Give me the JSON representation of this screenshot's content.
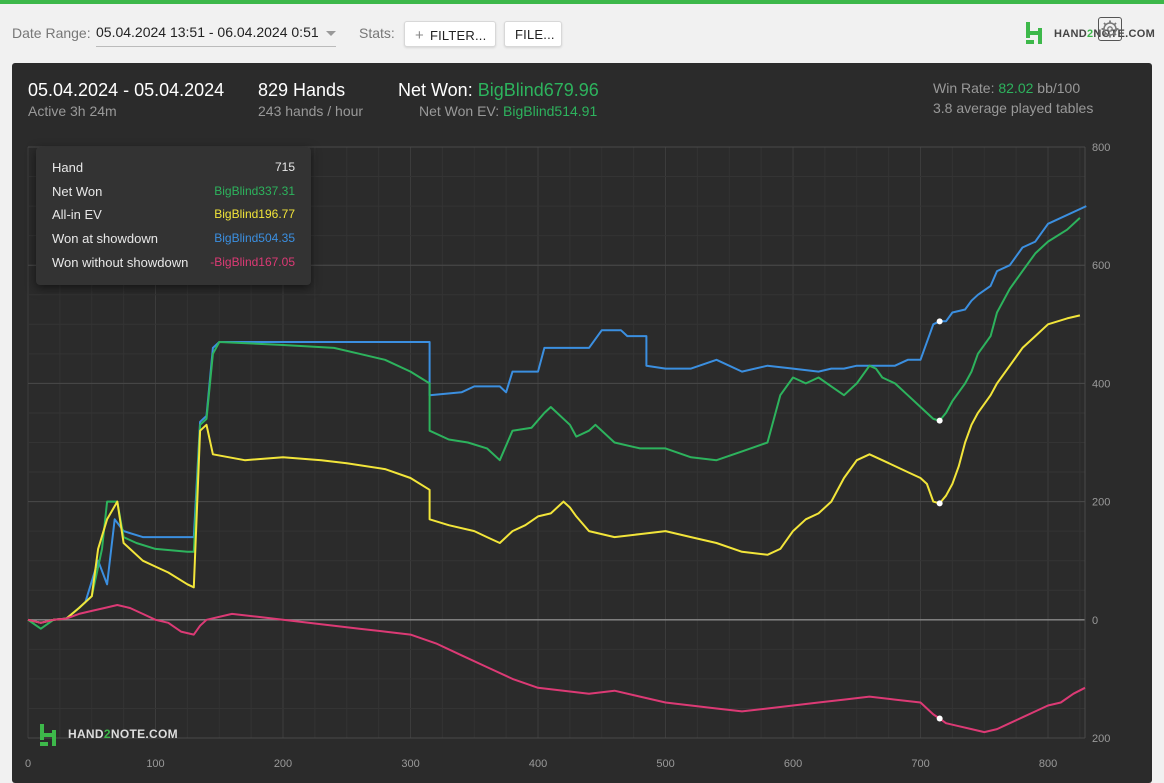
{
  "toolbar": {
    "date_range_label": "Date Range:",
    "date_range_value": "05.04.2024 13:51 - 06.04.2024 0:51",
    "stats_label": "Stats:",
    "filter_button": "FILTER...",
    "file_button": "FILE...",
    "logo_text_pre": "HAND",
    "logo_text_two": "2",
    "logo_text_post": "NOTE.COM"
  },
  "summary": {
    "dates": "05.04.2024 - 05.04.2024",
    "active": "Active 3h 24m",
    "hands": "829 Hands",
    "hands_per_hour": "243 hands / hour",
    "net_won_label": "Net Won:",
    "net_won_value": "BigBlind679.96",
    "net_won_ev_label": "Net Won  EV:",
    "net_won_ev_value": "BigBlind514.91",
    "win_rate_label": "Win Rate:",
    "win_rate_value": "82.02",
    "win_rate_unit": "bb/100",
    "avg_tables": "3.8 average played tables"
  },
  "tooltip": {
    "rows": [
      {
        "label": "Hand",
        "value": "715",
        "color": "#e8e8e8"
      },
      {
        "label": "Net Won",
        "value": "BigBlind337.31",
        "color": "#2db35d"
      },
      {
        "label": "All-in EV",
        "value": "BigBlind196.77",
        "color": "#f2e53a"
      },
      {
        "label": "Won at showdown",
        "value": "BigBlind504.35",
        "color": "#3b8fe0"
      },
      {
        "label": "Won without showdown",
        "value": "-BigBlind167.05",
        "color": "#dc3a75"
      }
    ]
  },
  "watermark": {
    "pre": "HAND",
    "two": "2",
    "post": "NOTE.COM"
  },
  "icons": {
    "gear": "gear-icon",
    "logo": "hand2note-logo-icon",
    "plus": "plus-icon",
    "caret": "chevron-down-icon"
  },
  "chart_data": {
    "type": "line",
    "xlim": [
      0,
      829
    ],
    "ylim": [
      -200,
      800
    ],
    "x_ticks": [
      0,
      100,
      200,
      300,
      400,
      500,
      600,
      700,
      800
    ],
    "y_ticks": [
      800,
      600,
      400,
      200,
      0,
      200
    ],
    "y_tick_values": [
      800,
      600,
      400,
      200,
      0,
      -200
    ],
    "grid": true,
    "highlight_x": 715,
    "series": [
      {
        "name": "Won at showdown",
        "color": "#3b8fe0",
        "points": [
          [
            0,
            0
          ],
          [
            10,
            -5
          ],
          [
            20,
            0
          ],
          [
            30,
            2
          ],
          [
            40,
            20
          ],
          [
            45,
            30
          ],
          [
            55,
            100
          ],
          [
            62,
            60
          ],
          [
            68,
            170
          ],
          [
            75,
            150
          ],
          [
            90,
            140
          ],
          [
            130,
            140
          ],
          [
            135,
            335
          ],
          [
            140,
            345
          ],
          [
            145,
            460
          ],
          [
            150,
            470
          ],
          [
            200,
            470
          ],
          [
            250,
            470
          ],
          [
            300,
            470
          ],
          [
            315,
            470
          ],
          [
            315,
            380
          ],
          [
            340,
            385
          ],
          [
            350,
            395
          ],
          [
            370,
            395
          ],
          [
            375,
            385
          ],
          [
            380,
            420
          ],
          [
            400,
            420
          ],
          [
            405,
            460
          ],
          [
            430,
            460
          ],
          [
            440,
            460
          ],
          [
            450,
            490
          ],
          [
            460,
            490
          ],
          [
            465,
            490
          ],
          [
            470,
            480
          ],
          [
            480,
            480
          ],
          [
            485,
            480
          ],
          [
            485,
            430
          ],
          [
            500,
            425
          ],
          [
            520,
            425
          ],
          [
            540,
            440
          ],
          [
            560,
            420
          ],
          [
            580,
            430
          ],
          [
            600,
            425
          ],
          [
            620,
            420
          ],
          [
            630,
            425
          ],
          [
            640,
            425
          ],
          [
            650,
            430
          ],
          [
            665,
            430
          ],
          [
            680,
            430
          ],
          [
            690,
            440
          ],
          [
            700,
            440
          ],
          [
            710,
            500
          ],
          [
            715,
            505
          ],
          [
            720,
            505
          ],
          [
            725,
            520
          ],
          [
            735,
            525
          ],
          [
            740,
            540
          ],
          [
            745,
            550
          ],
          [
            755,
            565
          ],
          [
            760,
            590
          ],
          [
            770,
            600
          ],
          [
            780,
            630
          ],
          [
            790,
            640
          ],
          [
            800,
            670
          ],
          [
            830,
            700
          ]
        ]
      },
      {
        "name": "Net Won",
        "color": "#2db35d",
        "points": [
          [
            0,
            0
          ],
          [
            10,
            -15
          ],
          [
            20,
            0
          ],
          [
            30,
            2
          ],
          [
            40,
            20
          ],
          [
            50,
            40
          ],
          [
            58,
            120
          ],
          [
            62,
            200
          ],
          [
            70,
            200
          ],
          [
            75,
            140
          ],
          [
            85,
            130
          ],
          [
            100,
            120
          ],
          [
            125,
            115
          ],
          [
            130,
            115
          ],
          [
            135,
            330
          ],
          [
            140,
            340
          ],
          [
            145,
            450
          ],
          [
            150,
            470
          ],
          [
            200,
            465
          ],
          [
            240,
            460
          ],
          [
            260,
            450
          ],
          [
            280,
            440
          ],
          [
            300,
            420
          ],
          [
            315,
            400
          ],
          [
            315,
            320
          ],
          [
            330,
            305
          ],
          [
            345,
            300
          ],
          [
            360,
            290
          ],
          [
            370,
            270
          ],
          [
            380,
            320
          ],
          [
            395,
            325
          ],
          [
            405,
            350
          ],
          [
            410,
            360
          ],
          [
            425,
            330
          ],
          [
            430,
            310
          ],
          [
            440,
            320
          ],
          [
            445,
            330
          ],
          [
            460,
            300
          ],
          [
            480,
            290
          ],
          [
            500,
            290
          ],
          [
            520,
            275
          ],
          [
            540,
            270
          ],
          [
            560,
            285
          ],
          [
            580,
            300
          ],
          [
            590,
            380
          ],
          [
            600,
            410
          ],
          [
            605,
            405
          ],
          [
            610,
            400
          ],
          [
            620,
            410
          ],
          [
            630,
            395
          ],
          [
            640,
            380
          ],
          [
            650,
            400
          ],
          [
            660,
            430
          ],
          [
            665,
            425
          ],
          [
            670,
            410
          ],
          [
            680,
            400
          ],
          [
            690,
            380
          ],
          [
            700,
            360
          ],
          [
            710,
            340
          ],
          [
            715,
            337
          ],
          [
            720,
            350
          ],
          [
            725,
            370
          ],
          [
            735,
            400
          ],
          [
            740,
            420
          ],
          [
            745,
            450
          ],
          [
            755,
            480
          ],
          [
            760,
            520
          ],
          [
            770,
            560
          ],
          [
            780,
            590
          ],
          [
            790,
            620
          ],
          [
            800,
            640
          ],
          [
            815,
            660
          ],
          [
            825,
            680
          ]
        ]
      },
      {
        "name": "All-in EV",
        "color": "#f2e53a",
        "points": [
          [
            0,
            0
          ],
          [
            10,
            -5
          ],
          [
            20,
            0
          ],
          [
            30,
            2
          ],
          [
            40,
            20
          ],
          [
            50,
            40
          ],
          [
            55,
            120
          ],
          [
            62,
            170
          ],
          [
            70,
            200
          ],
          [
            75,
            130
          ],
          [
            90,
            100
          ],
          [
            100,
            90
          ],
          [
            110,
            80
          ],
          [
            125,
            60
          ],
          [
            130,
            55
          ],
          [
            135,
            320
          ],
          [
            140,
            330
          ],
          [
            145,
            280
          ],
          [
            170,
            270
          ],
          [
            200,
            275
          ],
          [
            230,
            270
          ],
          [
            250,
            265
          ],
          [
            280,
            255
          ],
          [
            300,
            240
          ],
          [
            315,
            220
          ],
          [
            315,
            170
          ],
          [
            330,
            160
          ],
          [
            350,
            150
          ],
          [
            360,
            140
          ],
          [
            370,
            130
          ],
          [
            380,
            150
          ],
          [
            390,
            160
          ],
          [
            400,
            175
          ],
          [
            410,
            180
          ],
          [
            420,
            200
          ],
          [
            425,
            190
          ],
          [
            430,
            175
          ],
          [
            440,
            150
          ],
          [
            460,
            140
          ],
          [
            480,
            145
          ],
          [
            500,
            150
          ],
          [
            520,
            140
          ],
          [
            540,
            130
          ],
          [
            560,
            115
          ],
          [
            580,
            110
          ],
          [
            590,
            120
          ],
          [
            600,
            150
          ],
          [
            610,
            170
          ],
          [
            620,
            180
          ],
          [
            630,
            200
          ],
          [
            640,
            240
          ],
          [
            650,
            270
          ],
          [
            660,
            280
          ],
          [
            670,
            270
          ],
          [
            680,
            260
          ],
          [
            690,
            250
          ],
          [
            700,
            240
          ],
          [
            705,
            230
          ],
          [
            710,
            200
          ],
          [
            715,
            197
          ],
          [
            720,
            210
          ],
          [
            725,
            230
          ],
          [
            730,
            260
          ],
          [
            735,
            300
          ],
          [
            740,
            330
          ],
          [
            745,
            350
          ],
          [
            755,
            380
          ],
          [
            760,
            400
          ],
          [
            770,
            430
          ],
          [
            780,
            460
          ],
          [
            790,
            480
          ],
          [
            800,
            500
          ],
          [
            815,
            510
          ],
          [
            825,
            515
          ]
        ]
      },
      {
        "name": "Won without showdown",
        "color": "#dc3a75",
        "points": [
          [
            0,
            0
          ],
          [
            10,
            -5
          ],
          [
            20,
            0
          ],
          [
            30,
            2
          ],
          [
            40,
            10
          ],
          [
            50,
            15
          ],
          [
            60,
            20
          ],
          [
            70,
            25
          ],
          [
            80,
            20
          ],
          [
            90,
            10
          ],
          [
            100,
            0
          ],
          [
            110,
            -5
          ],
          [
            120,
            -20
          ],
          [
            130,
            -25
          ],
          [
            135,
            -10
          ],
          [
            140,
            0
          ],
          [
            160,
            10
          ],
          [
            180,
            5
          ],
          [
            200,
            0
          ],
          [
            220,
            -5
          ],
          [
            240,
            -10
          ],
          [
            260,
            -15
          ],
          [
            280,
            -20
          ],
          [
            300,
            -25
          ],
          [
            320,
            -40
          ],
          [
            340,
            -60
          ],
          [
            360,
            -80
          ],
          [
            380,
            -100
          ],
          [
            400,
            -115
          ],
          [
            420,
            -120
          ],
          [
            440,
            -125
          ],
          [
            460,
            -120
          ],
          [
            480,
            -130
          ],
          [
            500,
            -140
          ],
          [
            520,
            -145
          ],
          [
            540,
            -150
          ],
          [
            560,
            -155
          ],
          [
            580,
            -150
          ],
          [
            600,
            -145
          ],
          [
            620,
            -140
          ],
          [
            640,
            -135
          ],
          [
            660,
            -130
          ],
          [
            680,
            -135
          ],
          [
            700,
            -140
          ],
          [
            710,
            -160
          ],
          [
            715,
            -167
          ],
          [
            720,
            -175
          ],
          [
            730,
            -180
          ],
          [
            740,
            -185
          ],
          [
            750,
            -190
          ],
          [
            760,
            -185
          ],
          [
            770,
            -175
          ],
          [
            780,
            -165
          ],
          [
            790,
            -155
          ],
          [
            800,
            -145
          ],
          [
            810,
            -140
          ],
          [
            820,
            -125
          ],
          [
            829,
            -115
          ]
        ]
      }
    ]
  }
}
